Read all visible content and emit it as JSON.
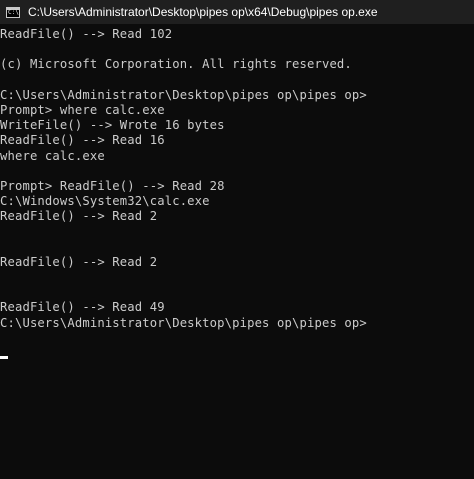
{
  "window": {
    "title": "C:\\Users\\Administrator\\Desktop\\pipes op\\x64\\Debug\\pipes op.exe",
    "icon": "console-app-icon",
    "icon_glyph": "C:\\"
  },
  "console": {
    "lines": [
      "ReadFile() --> Read 102",
      "",
      "(c) Microsoft Corporation. All rights reserved.",
      "",
      "C:\\Users\\Administrator\\Desktop\\pipes op\\pipes op>",
      "Prompt> where calc.exe",
      "WriteFile() --> Wrote 16 bytes",
      "ReadFile() --> Read 16",
      "where calc.exe",
      "",
      "Prompt> ReadFile() --> Read 28",
      "C:\\Windows\\System32\\calc.exe",
      "ReadFile() --> Read 2",
      "",
      "",
      "ReadFile() --> Read 2",
      "",
      "",
      "ReadFile() --> Read 49",
      "C:\\Users\\Administrator\\Desktop\\pipes op\\pipes op>",
      ""
    ]
  },
  "colors": {
    "background": "#0c0c0c",
    "titlebar": "#1f1f1f",
    "text": "#cccccc",
    "cursor": "#ffffff"
  }
}
